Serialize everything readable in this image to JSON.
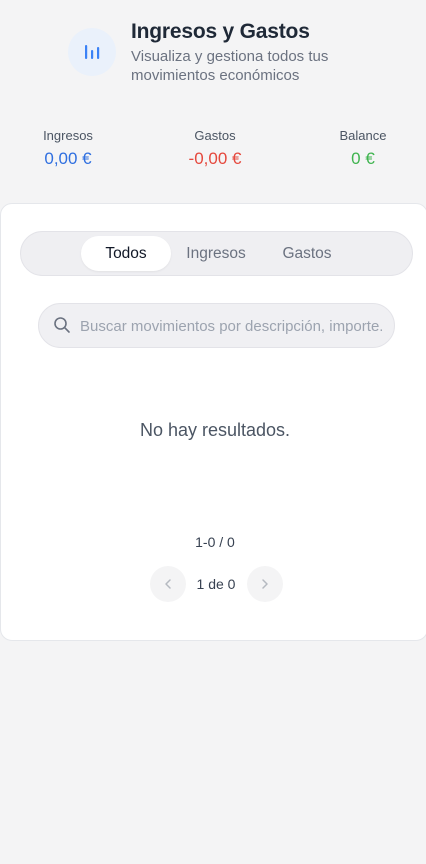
{
  "header": {
    "title": "Ingresos y Gastos",
    "subtitle": "Visualiza y gestiona todos tus movimientos económicos",
    "icon": "chart-bars-icon"
  },
  "stats": {
    "ingresos": {
      "label": "Ingresos",
      "value": "0,00 €",
      "color": "#2f6fe0"
    },
    "gastos": {
      "label": "Gastos",
      "value": "-0,00 €",
      "color": "#e5483d"
    },
    "balance": {
      "label": "Balance",
      "value": "0 €",
      "color": "#3fb44f"
    }
  },
  "tabs": [
    {
      "label": "Todos",
      "active": true
    },
    {
      "label": "Ingresos",
      "active": false
    },
    {
      "label": "Gastos",
      "active": false
    }
  ],
  "search": {
    "placeholder": "Buscar movimientos por descripción, importe...",
    "value": ""
  },
  "empty_text": "No hay resultados.",
  "pagination": {
    "range": "1-0 / 0",
    "page": "1 de 0"
  }
}
